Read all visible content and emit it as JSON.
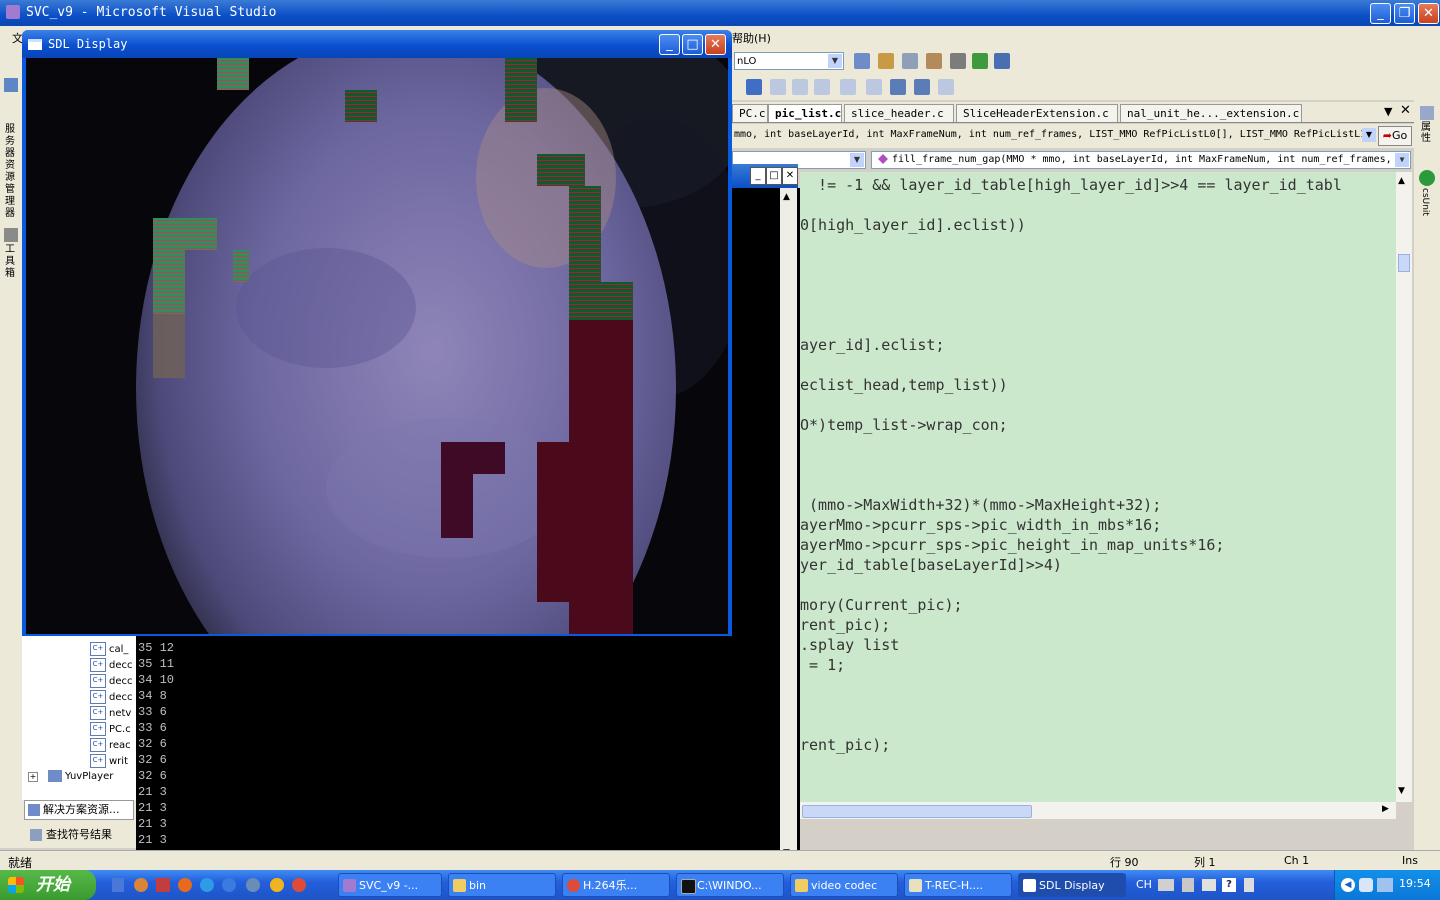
{
  "vs": {
    "title": "SVC_v9 - Microsoft Visual Studio",
    "menu_left": "文",
    "menu_help": "帮助(H)",
    "config_combo": "nLO",
    "go_label": "Go"
  },
  "tabs": [
    "PC.c",
    "pic_list.c",
    "slice_header.c",
    "SliceHeaderExtension.c",
    "nal_unit_he..._extension.c"
  ],
  "nav": {
    "signature": "mmo, int baseLayerId, int MaxFrameNum, int num_ref_frames, LIST_MMO RefPicListL0[], LIST_MMO RefPicListL1",
    "function_combo": "fill_frame_num_gap(MMO * mmo, int baseLayerId, int MaxFrameNum, int num_ref_frames,"
  },
  "code_lines": [
    "  != -1 && layer_id_table[high_layer_id]>>4 == layer_id_tabl",
    "",
    "0[high_layer_id].eclist))",
    "",
    "",
    "",
    "",
    "",
    "ayer_id].eclist;",
    "",
    "eclist_head,temp_list))",
    "",
    "O*)temp_list->wrap_con;",
    "",
    "",
    "",
    " (mmo->MaxWidth+32)*(mmo->MaxHeight+32);",
    "ayerMmo->pcurr_sps->pic_width_in_mbs*16;",
    "ayerMmo->pcurr_sps->pic_height_in_map_units*16;",
    "yer_id_table[baseLayerId]>>4)",
    "",
    "mory(Current_pic);",
    "rent_pic);",
    ".splay list",
    " = 1;",
    "",
    "",
    "",
    "rent_pic);"
  ],
  "console_lines": [
    "35 12",
    "35 11",
    "34 10",
    "34 8",
    "33 6",
    "33 6",
    "32 6",
    "32 6",
    "32 6",
    "21 3",
    "21 3",
    "21 3",
    "21 3"
  ],
  "solution": {
    "files": [
      "cal_",
      "decc",
      "decc",
      "decc",
      "netv",
      "PC.c",
      "reac",
      "writ"
    ],
    "project": "YuvPlayer",
    "tab_solution": "解决方案资源...",
    "tab_find": "查找符号结果"
  },
  "left_strip": {
    "server": "服务器资源管理器",
    "toolbox": "工具箱"
  },
  "right_strip": {
    "props": "属性",
    "csunit": "csUnit"
  },
  "status": {
    "ready": "就绪",
    "line": "行 90",
    "col": "列 1",
    "ch": "Ch 1",
    "ins": "Ins"
  },
  "sdl": {
    "title": "SDL Display"
  },
  "taskbar": {
    "start": "开始",
    "tasks": [
      "SVC_v9 -...",
      "bin",
      "H.264乐...",
      "C:\\WINDO...",
      "video codec",
      "T-REC-H....",
      "SDL Display"
    ],
    "lang": "CH",
    "clock": "19:54"
  }
}
